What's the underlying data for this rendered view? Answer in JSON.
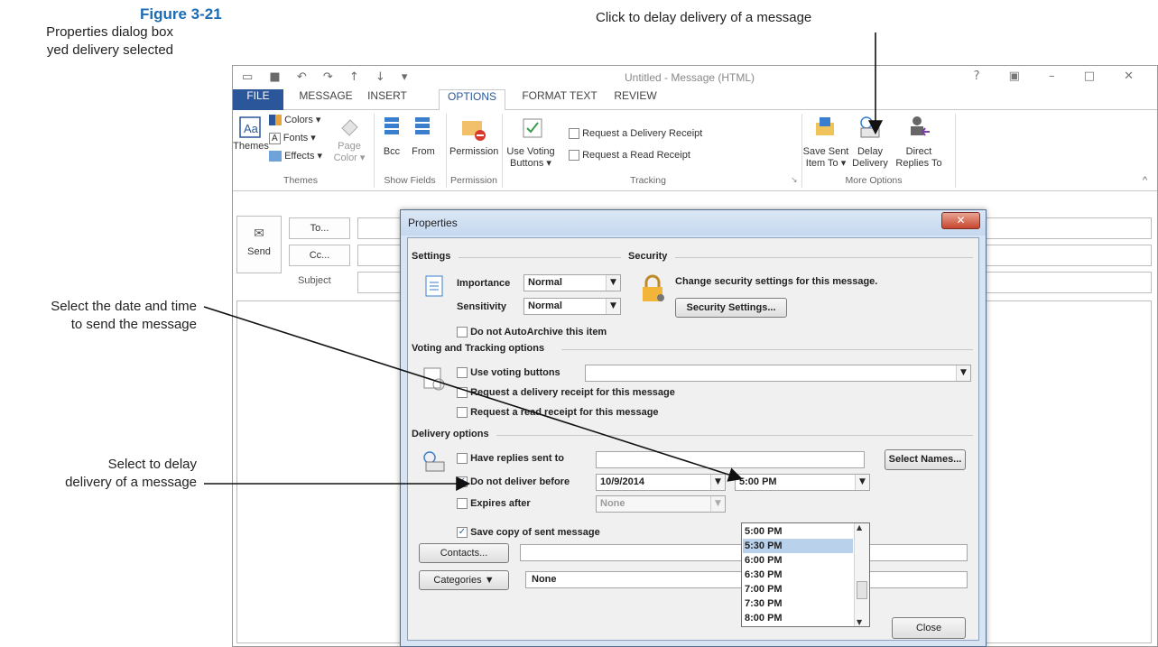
{
  "captions": {
    "figure": "Figure 3-21",
    "figure_desc": "Properties dialog box\nyed delivery selected",
    "callout_delay": "Click to delay delivery of a message",
    "callout_datetime": "Select the date and time\nto send the message",
    "callout_checkbox": "Select to delay\ndelivery of a message"
  },
  "window": {
    "title": "Untitled - Message (HTML)",
    "controls": "? ▣ – □ ✕"
  },
  "tabs": [
    "FILE",
    "MESSAGE",
    "INSERT",
    "OPTIONS",
    "FORMAT TEXT",
    "REVIEW"
  ],
  "active_tab": "OPTIONS",
  "ribbon": {
    "themes": {
      "label": "Themes",
      "colors": "Colors ▾",
      "fonts": "Fonts ▾",
      "effects": "Effects ▾",
      "page_color": "Page Color ▾",
      "group": "Themes"
    },
    "show_fields": {
      "bcc": "Bcc",
      "from": "From",
      "group": "Show Fields"
    },
    "permission": {
      "label": "Permission",
      "group": "Permission"
    },
    "tracking": {
      "voting": "Use Voting Buttons ▾",
      "delivery_receipt": "Request a Delivery Receipt",
      "read_receipt": "Request a Read Receipt",
      "group": "Tracking"
    },
    "more_options": {
      "save_sent": "Save Sent Item To ▾",
      "delay": "Delay Delivery",
      "direct": "Direct Replies To",
      "group": "More Options"
    }
  },
  "compose": {
    "send": "Send",
    "to": "To...",
    "cc": "Cc...",
    "subject": "Subject"
  },
  "dialog": {
    "title": "Properties",
    "close_x": "✕",
    "settings": "Settings",
    "importance_label": "Importance",
    "importance_value": "Normal",
    "sensitivity_label": "Sensitivity",
    "sensitivity_value": "Normal",
    "security": "Security",
    "security_text": "Change security settings for this message.",
    "security_button": "Security Settings...",
    "autoarchive": "Do not AutoArchive this item",
    "voting_section": "Voting and Tracking options",
    "use_voting": "Use voting buttons",
    "req_delivery": "Request a delivery receipt for this message",
    "req_read": "Request a read receipt for this message",
    "delivery_section": "Delivery options",
    "have_replies": "Have replies sent to",
    "select_names": "Select Names...",
    "do_not_deliver": "Do not deliver before",
    "deliver_date": "10/9/2014",
    "deliver_time": "5:00 PM",
    "expires_after": "Expires after",
    "expires_value": "None",
    "save_copy": "Save copy of sent message",
    "contacts": "Contacts...",
    "categories": "Categories",
    "categories_value": "None",
    "close": "Close",
    "time_options": [
      "5:00 PM",
      "5:30 PM",
      "6:00 PM",
      "6:30 PM",
      "7:00 PM",
      "7:30 PM",
      "8:00 PM"
    ],
    "time_selected": "5:30 PM"
  },
  "colors": {
    "accent": "#2b579a",
    "figure": "#1b6cb5"
  }
}
